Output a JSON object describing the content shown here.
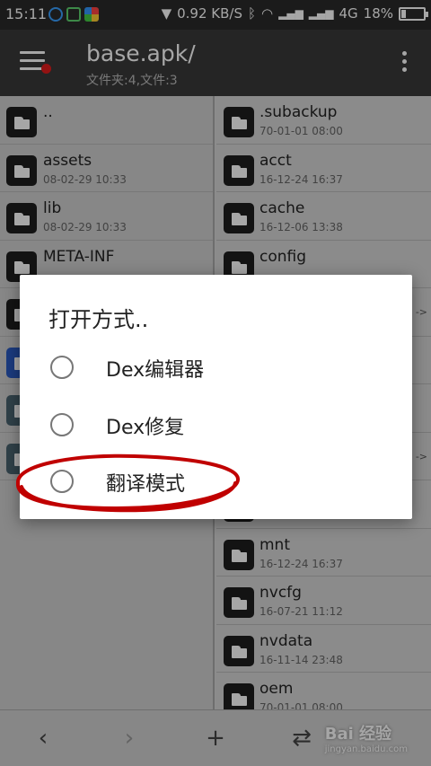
{
  "status_bar": {
    "time": "15:11",
    "speed": "0.92 KB/S",
    "network": "4G",
    "battery": "18%",
    "battery_level": 0.18
  },
  "app_bar": {
    "title": "base.apk/",
    "subtitle": "文件夹:4,文件:3",
    "menu_icon": "hamburger-icon",
    "more_icon": "more-vert-icon"
  },
  "left_pane": {
    "items": [
      {
        "name": "..",
        "date": ""
      },
      {
        "name": "assets",
        "date": "08-02-29 10:33"
      },
      {
        "name": "lib",
        "date": "08-02-29 10:33"
      },
      {
        "name": "META-INF",
        "date": ""
      }
    ]
  },
  "right_pane": {
    "items": [
      {
        "name": ".subackup",
        "date": "70-01-01 08:00"
      },
      {
        "name": "acct",
        "date": "16-12-24 16:37"
      },
      {
        "name": "cache",
        "date": "16-12-06 13:38"
      },
      {
        "name": "config",
        "date": ""
      },
      {
        "name": "",
        "date": "",
        "arrow": "->"
      },
      {
        "name": "",
        "date": "",
        "arrow": ""
      },
      {
        "name": "",
        "date": "",
        "arrow": ""
      },
      {
        "name": "",
        "date": "",
        "arrow": "->"
      },
      {
        "name": "",
        "date": ""
      },
      {
        "name": "mnt",
        "date": "16-12-24 16:37"
      },
      {
        "name": "nvcfg",
        "date": "16-07-21 11:12"
      },
      {
        "name": "nvdata",
        "date": "16-11-14 23:48"
      },
      {
        "name": "oem",
        "date": "70-01-01 08:00"
      }
    ]
  },
  "bottom_bar": {
    "back": "‹",
    "forward": "›",
    "add": "+",
    "swap": "⇄",
    "watermark": "Bai 经验",
    "watermark_sub": "jingyan.baidu.com"
  },
  "dialog": {
    "title": "打开方式..",
    "options": [
      {
        "label": "Dex编辑器"
      },
      {
        "label": "Dex修复"
      },
      {
        "label": "翻译模式"
      }
    ],
    "annotation_color": "#c00000"
  }
}
